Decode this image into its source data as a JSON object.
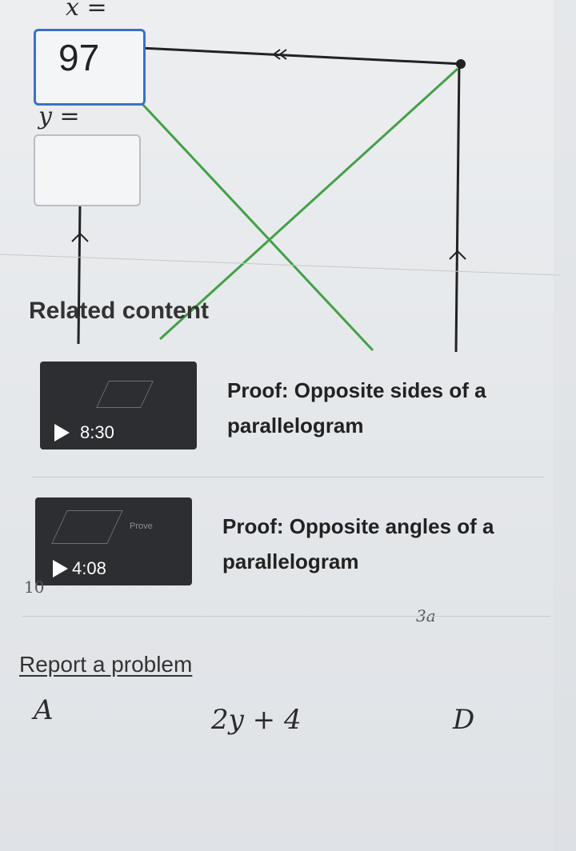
{
  "question": {
    "x_label": "x =",
    "x_value": "97",
    "y_label": "y =",
    "y_value": ""
  },
  "related": {
    "title": "Related content",
    "videos": [
      {
        "duration": "8:30",
        "title_line1": "Proof: Opposite sides of a",
        "title_line2": "parallelogram"
      },
      {
        "duration": "4:08",
        "title_line1": "Proof: Opposite angles of a",
        "title_line2": "parallelogram",
        "thumb_caption": "Prove"
      }
    ]
  },
  "report_link": "Report a problem",
  "diagram_labels": {
    "vertex_a": "A",
    "vertex_d": "D",
    "side_expression": "2y + 4",
    "bg_label_left": "10",
    "bg_label_right": "3a"
  },
  "colors": {
    "accent": "#3b71c4",
    "diagonal": "#43a047",
    "link": "#333333"
  }
}
